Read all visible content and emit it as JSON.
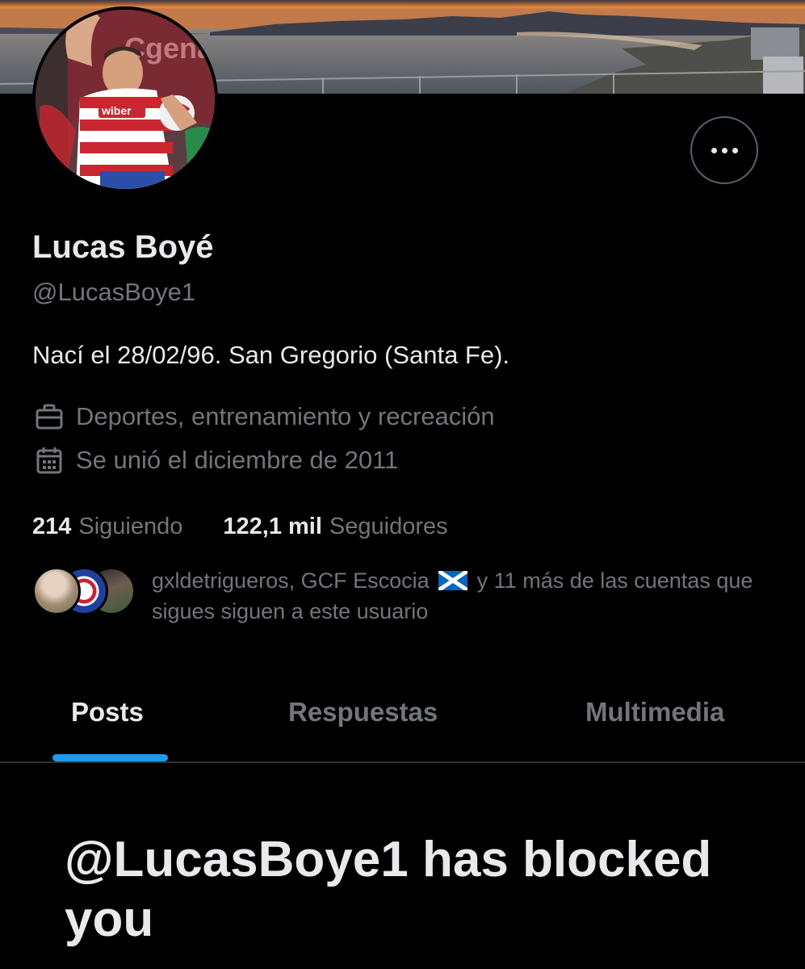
{
  "profile": {
    "display_name": "Lucas Boyé",
    "handle": "@LucasBoye1",
    "bio": "Nací el 28/02/96. San Gregorio (Santa Fe).",
    "category": "Deportes, entrenamiento y recreación",
    "joined": "Se unió el diciembre de 2011",
    "avatar_jersey_text": "wiber",
    "avatar_background_text": "Cgena",
    "category_icon": "briefcase-icon",
    "joined_icon": "calendar-icon",
    "more_icon": "more-options-icon"
  },
  "stats": {
    "following_count": "214",
    "following_label": "Siguiendo",
    "followers_count": "122,1 mil",
    "followers_label": "Seguidores"
  },
  "followed_by": {
    "text_before_flag": "gxldetrigueros, GCF Escocia",
    "flag": "scotland-flag",
    "text_after_flag": "y 11 más de las cuentas que sigues siguen a este usuario"
  },
  "tabs": [
    {
      "label": "Posts",
      "active": true
    },
    {
      "label": "Respuestas",
      "active": false
    },
    {
      "label": "Multimedia",
      "active": false
    }
  ],
  "blocked": {
    "message": "@LucasBoye1 has blocked you"
  },
  "colors": {
    "background": "#000000",
    "primary_text": "#e7e9ea",
    "secondary_text": "#71767b",
    "accent": "#1d9bf0",
    "border": "#2f3336"
  }
}
